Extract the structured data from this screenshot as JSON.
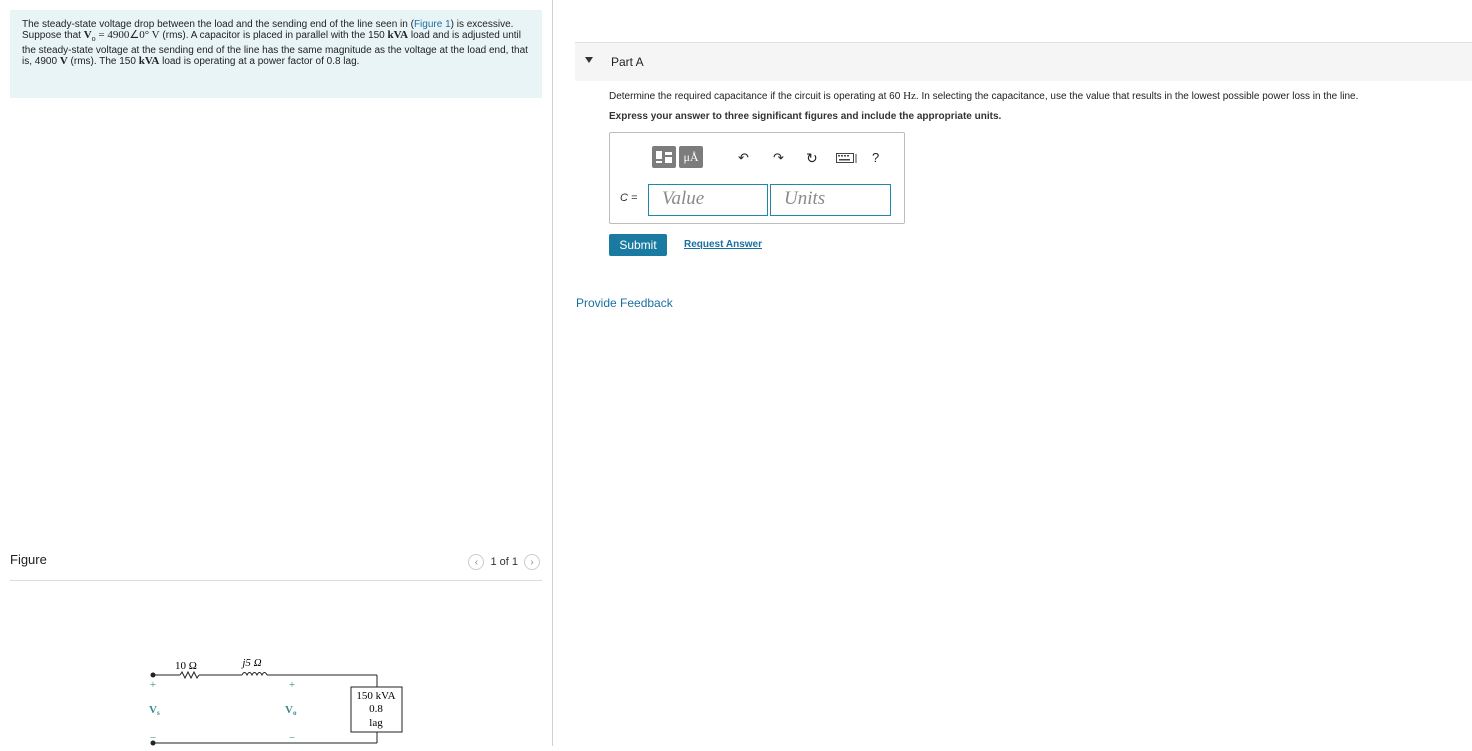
{
  "problem": {
    "part1": "The steady-state voltage drop between the load and the sending end of the line seen in (",
    "figure_link": "Figure 1",
    "part2": ") is excessive. Suppose that ",
    "vo_expr": "V",
    "vo_sub": "o",
    "vo_value": " = 4900∠0° V",
    "part3": " (rms). A capacitor is placed in parallel with the 150 ",
    "kva1": "kVA",
    "part4": " load and is adjusted until the steady-state voltage at the sending end of the line has the same magnitude as the voltage at the load end, that is, 4900  ",
    "v_unit": "V",
    "part5": " (rms). The 150 ",
    "kva2": "kVA",
    "part6": " load is operating at a power factor of 0.8 lag."
  },
  "figure": {
    "title": "Figure",
    "pager_text": "1 of 1",
    "prev_icon": "chevron-left-icon",
    "next_icon": "chevron-right-icon"
  },
  "circuit": {
    "r_label": "10 Ω",
    "x_label": "j5 Ω",
    "vs_label": "V",
    "vs_sub": "s",
    "vo_label": "V",
    "vo_sub": "o",
    "plus": "+",
    "minus": "−",
    "load_line1": "150 kVA",
    "load_line2": "0.8",
    "load_line3": "lag"
  },
  "part_a": {
    "title": "Part A",
    "question_pre": "Determine the required capacitance if the circuit is operating at 60 ",
    "question_unit": "Hz",
    "question_post": ". In selecting the capacitance, use the value that results in the lowest possible power loss in the line.",
    "instruction": "Express your answer to three significant figures and include the appropriate units.",
    "toolbar": {
      "templates_icon": "templates-icon",
      "units_button": "μÅ",
      "undo_icon": "undo-icon",
      "redo_icon": "redo-icon",
      "reset_icon": "reset-icon",
      "keyboard_icon": "keyboard-icon",
      "help": "?"
    },
    "answer_label": "C =",
    "value_placeholder": "Value",
    "units_placeholder": "Units",
    "submit": "Submit",
    "request_answer": "Request Answer"
  },
  "feedback": "Provide Feedback",
  "colors": {
    "accent": "#1a7aa1",
    "problem_bg": "#e9f4f6",
    "link": "#1a6fa0"
  }
}
